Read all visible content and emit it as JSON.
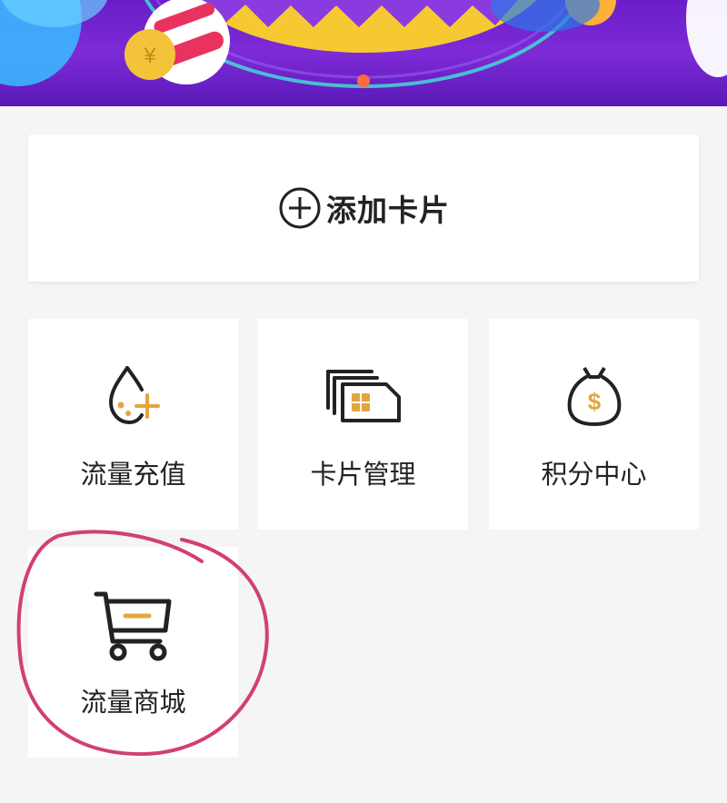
{
  "add_card": {
    "label": "添加卡片",
    "icon": "plus-circle-icon"
  },
  "tiles": [
    {
      "label": "流量充值",
      "icon": "water-drop-plus-icon"
    },
    {
      "label": "卡片管理",
      "icon": "sim-cards-icon"
    },
    {
      "label": "积分中心",
      "icon": "money-bag-icon"
    },
    {
      "label": "流量商城",
      "icon": "shopping-cart-icon"
    }
  ],
  "banner": {
    "active_slide": 1,
    "colors": {
      "primary": "#6a1ec9",
      "dot": "#ff6a3d"
    }
  },
  "accent_color": "#e5a53d",
  "annotation_color": "#d23f74"
}
